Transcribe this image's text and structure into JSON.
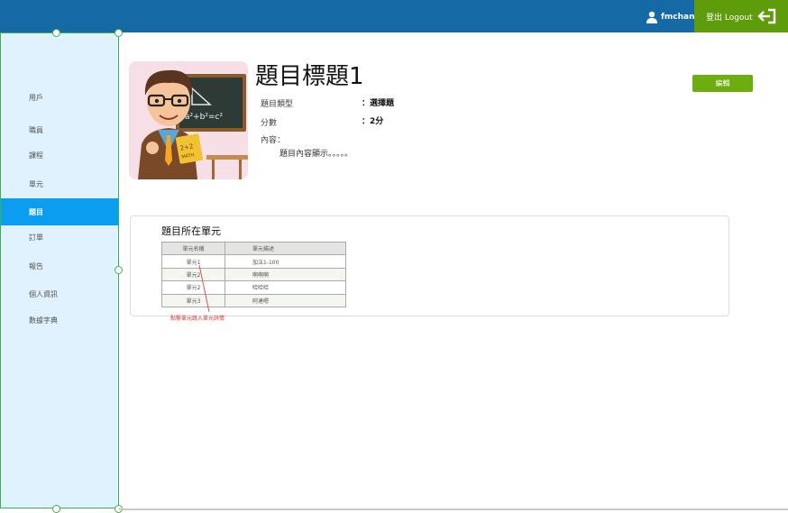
{
  "header": {
    "username": "fmchan",
    "logout_label": "登出 Logout",
    "icons": {
      "user": "user-icon",
      "logout": "logout-arrow-icon"
    },
    "colors": {
      "bar": "#156aa6",
      "logout": "#5e9c0c"
    }
  },
  "sidebar": {
    "items": [
      {
        "label": "用戶"
      },
      {
        "label": "職員"
      },
      {
        "label": "課程"
      },
      {
        "label": "單元"
      },
      {
        "label": "題目"
      },
      {
        "label": "訂單"
      },
      {
        "label": "報告"
      },
      {
        "label": "個人資訊"
      },
      {
        "label": "數據字典"
      }
    ],
    "active": "題目",
    "colors": {
      "background": "#e0f2fd",
      "active": "#0b9df0"
    }
  },
  "question": {
    "title": "題目標題1",
    "edit_label": "編輯",
    "type_label": "題目類型",
    "type_value": "：選擇題",
    "score_label": "分數",
    "score_value": "：2分",
    "content_label": "內容：",
    "content_value": "題目內容顯示。。。。。",
    "image": "teacher-illustration"
  },
  "units_section": {
    "title": "題目所在單元",
    "columns": [
      "單元名稱",
      "單元描述"
    ],
    "rows": [
      [
        "單元1",
        "加法1-100"
      ],
      [
        "單元2",
        "啊啊啊"
      ],
      [
        "單元2",
        "哈哈哈"
      ],
      [
        "單元3",
        "阿達嗯"
      ]
    ],
    "annotation": "點擊單元跳入單元詳情"
  }
}
